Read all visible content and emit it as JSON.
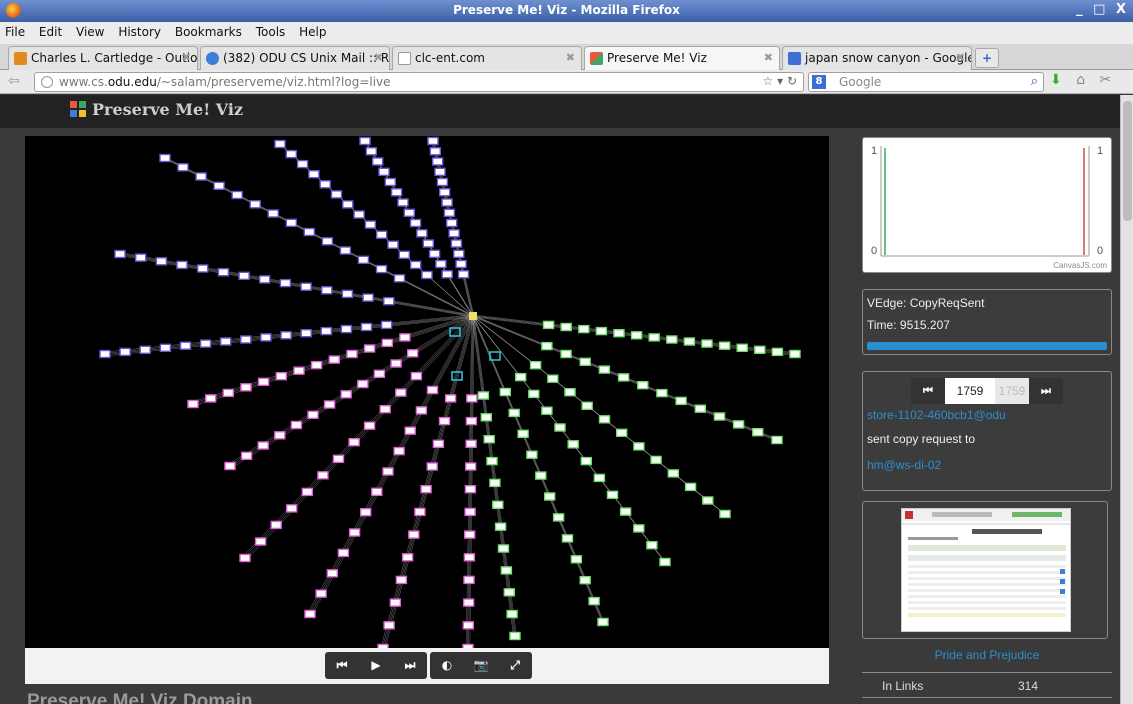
{
  "window": {
    "title": "Preserve Me! Viz - Mozilla Firefox",
    "controls": "_ □ X"
  },
  "menu": [
    "File",
    "Edit",
    "View",
    "History",
    "Bookmarks",
    "Tools",
    "Help"
  ],
  "tabs": [
    {
      "label": "Charles L. Cartledge - Outlo...",
      "color": "#e08a1f"
    },
    {
      "label": "(382) ODU CS Unix Mail :: Re...",
      "color": "#3b7dd8"
    },
    {
      "label": "clc-ent.com",
      "color": "#ffffff"
    },
    {
      "label": "Preserve Me! Viz",
      "color": "#e85a3c"
    },
    {
      "label": "japan snow canyon - Google...",
      "color": "#3b6fd6"
    }
  ],
  "newtab_label": "+",
  "nav": {
    "url_prefix": "www.cs.",
    "url_domain": "odu.edu",
    "url_rest": "/~salam/preserveme/viz.html?log=live",
    "search_engine_badge": "8",
    "search_placeholder": "Google"
  },
  "app": {
    "name": "Preserve Me! Viz"
  },
  "colors": {
    "accent": "#2a8fd0",
    "node_blue": "#6f52d8",
    "node_pink": "#e060d8",
    "node_green": "#6fe06a",
    "hub": "#f0e060",
    "edge": "#bdbdbd"
  },
  "graph_controls": {
    "first": "⏮",
    "play": "▶",
    "last": "⏭",
    "contrast": "◐",
    "camera": "📷",
    "expand": "⤢"
  },
  "chart": {
    "y_left_top": "1",
    "y_left_bottom": "0",
    "y_right_top": "1",
    "y_right_bottom": "0",
    "credit": "CanvasJS.com",
    "left_color": "#3aa860",
    "right_color": "#d04848"
  },
  "info": {
    "edge": "VEdge: CopyReqSent",
    "time": "Time: 9515.207"
  },
  "stepper": {
    "first": "⏮",
    "last": "⏭",
    "current": "1759",
    "total": "1759",
    "source": "store-1102-460bcb1@odu",
    "action": "sent copy request to",
    "target": "hm@ws-di-02"
  },
  "book": {
    "title": "Pride and Prejudice",
    "in_links_label": "In Links",
    "in_links_value": "314"
  },
  "page_heading_partial": "Preserve Me! Viz Domain"
}
